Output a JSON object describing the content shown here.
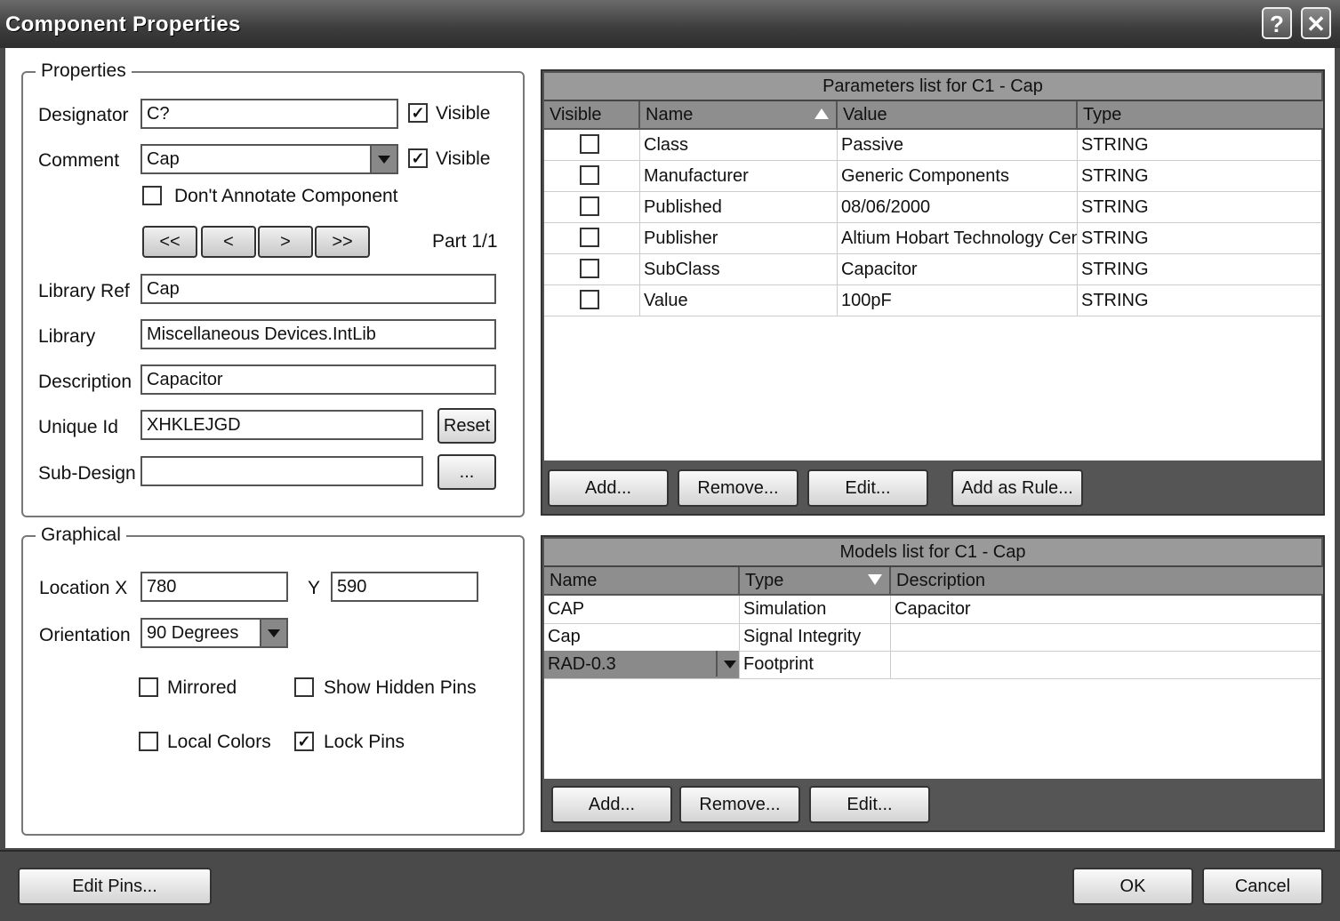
{
  "window": {
    "title": "Component Properties",
    "help_glyph": "?",
    "close_glyph": "✕"
  },
  "properties": {
    "group_label": "Properties",
    "designator_label": "Designator",
    "designator_value": "C?",
    "designator_visible_label": "Visible",
    "designator_visible_checked": true,
    "comment_label": "Comment",
    "comment_value": "Cap",
    "comment_visible_label": "Visible",
    "comment_visible_checked": true,
    "dont_annotate_label": "Don't Annotate Component",
    "dont_annotate_checked": false,
    "nav_first": "<<",
    "nav_prev": "<",
    "nav_next": ">",
    "nav_last": ">>",
    "part_label": "Part 1/1",
    "library_ref_label": "Library Ref",
    "library_ref_value": "Cap",
    "library_label": "Library",
    "library_value": "Miscellaneous Devices.IntLib",
    "description_label": "Description",
    "description_value": "Capacitor",
    "unique_id_label": "Unique Id",
    "unique_id_value": "XHKLEJGD",
    "reset_label": "Reset",
    "sub_design_label": "Sub-Design",
    "sub_design_value": "",
    "browse_label": "..."
  },
  "graphical": {
    "group_label": "Graphical",
    "location_x_label": "Location X",
    "location_x_value": "780",
    "location_y_label": "Y",
    "location_y_value": "590",
    "orientation_label": "Orientation",
    "orientation_value": "90 Degrees",
    "mirrored_label": "Mirrored",
    "mirrored_checked": false,
    "show_hidden_pins_label": "Show Hidden Pins",
    "show_hidden_pins_checked": false,
    "local_colors_label": "Local Colors",
    "local_colors_checked": false,
    "lock_pins_label": "Lock Pins",
    "lock_pins_checked": true
  },
  "parameters": {
    "header": "Parameters list for C1 - Cap",
    "columns": [
      "Visible",
      "Name",
      "Value",
      "Type"
    ],
    "rows": [
      {
        "visible": false,
        "name": "Class",
        "value": "Passive",
        "type": "STRING"
      },
      {
        "visible": false,
        "name": "Manufacturer",
        "value": "Generic Components",
        "type": "STRING"
      },
      {
        "visible": false,
        "name": "Published",
        "value": "08/06/2000",
        "type": "STRING"
      },
      {
        "visible": false,
        "name": "Publisher",
        "value": "Altium Hobart Technology Cen",
        "type": "STRING"
      },
      {
        "visible": false,
        "name": "SubClass",
        "value": "Capacitor",
        "type": "STRING"
      },
      {
        "visible": false,
        "name": "Value",
        "value": "100pF",
        "type": "STRING"
      }
    ],
    "add_label": "Add...",
    "remove_label": "Remove...",
    "edit_label": "Edit...",
    "add_as_rule_label": "Add as Rule..."
  },
  "models": {
    "header": "Models list for C1 - Cap",
    "columns": [
      "Name",
      "Type",
      "Description"
    ],
    "rows": [
      {
        "name": "CAP",
        "type": "Simulation",
        "description": "Capacitor"
      },
      {
        "name": "Cap",
        "type": "Signal Integrity",
        "description": ""
      },
      {
        "name": "RAD-0.3",
        "type": "Footprint",
        "description": ""
      }
    ],
    "add_label": "Add...",
    "remove_label": "Remove...",
    "edit_label": "Edit..."
  },
  "footer": {
    "edit_pins_label": "Edit Pins...",
    "ok_label": "OK",
    "cancel_label": "Cancel"
  },
  "check_glyph": "✓"
}
